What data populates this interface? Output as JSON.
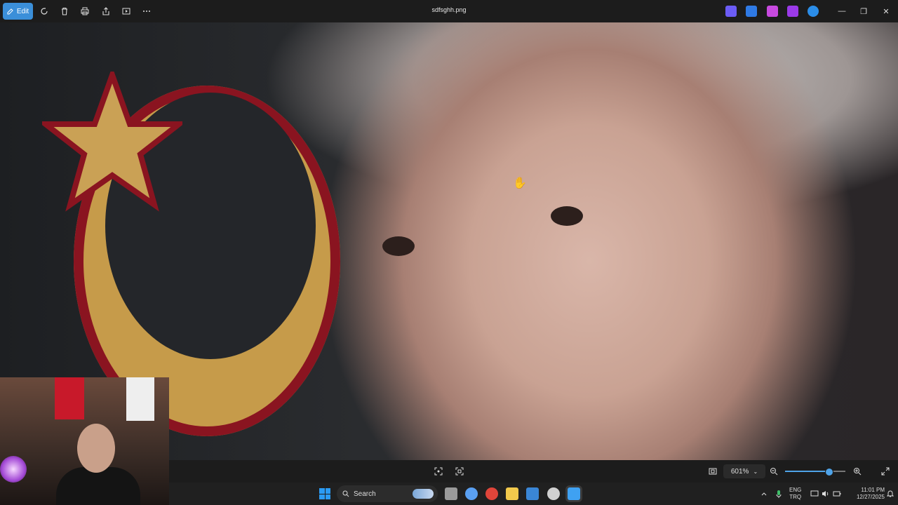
{
  "window": {
    "title": "sdfsghh.png",
    "edit_label": "Edit",
    "minimize": "—",
    "maximize": "❐",
    "close": "✕"
  },
  "toolbar": {
    "icons": [
      "edit-icon",
      "rotate-icon",
      "delete-icon",
      "print-icon",
      "share-icon",
      "slideshow-icon",
      "more-icon"
    ],
    "extensions": [
      {
        "name": "copilot-icon",
        "color": "#6b5cf6"
      },
      {
        "name": "designer-icon",
        "color": "#2f7ae5"
      },
      {
        "name": "clipchamp-icon",
        "color": "#c84ae0"
      },
      {
        "name": "clipchamp-video-icon",
        "color": "#9b3ae8"
      },
      {
        "name": "onedrive-icon",
        "color": "#2b8de8"
      }
    ]
  },
  "viewer": {
    "zoom_label": "601%",
    "zoom_level": 0.72
  },
  "taskbar": {
    "search_placeholder": "Search",
    "language_line1": "ENG",
    "language_line2": "TRQ",
    "time": "11:01 PM",
    "date": "12/27/2025",
    "apps": [
      {
        "name": "task-view-icon",
        "color": "#9a9a9a"
      },
      {
        "name": "copilot-app-icon",
        "color": "#5aa0f2"
      },
      {
        "name": "chrome-icon",
        "color": "#e0453a"
      },
      {
        "name": "file-explorer-icon",
        "color": "#f2c94c"
      },
      {
        "name": "photos-icon",
        "color": "#3a86d6"
      },
      {
        "name": "recorder-icon",
        "color": "#d0d0d0"
      },
      {
        "name": "photos-active-icon",
        "color": "#3fa1f2"
      }
    ]
  }
}
